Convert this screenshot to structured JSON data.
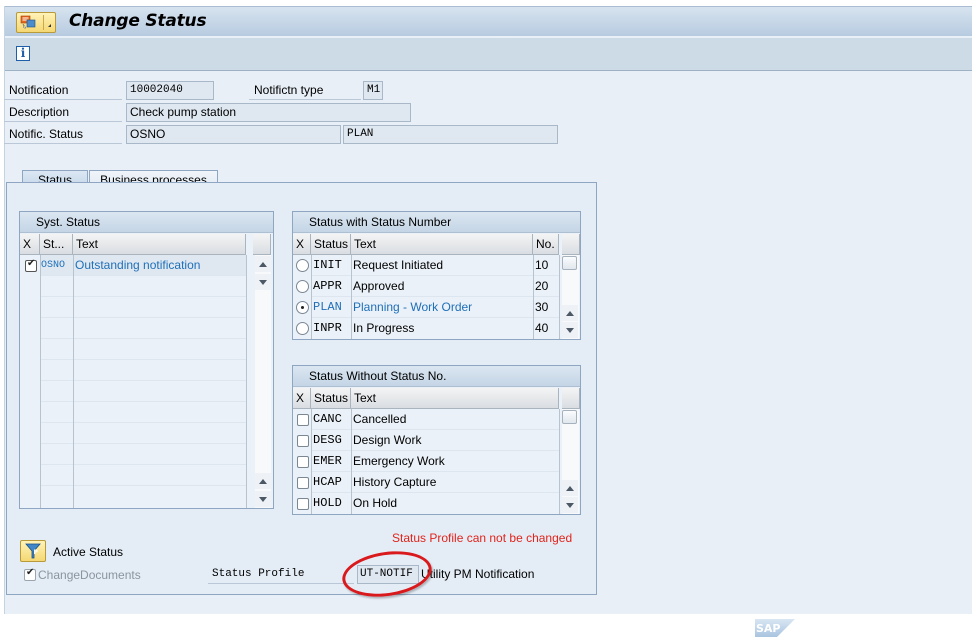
{
  "window": {
    "title": "Change Status"
  },
  "toolbar": {
    "info_icon": "i"
  },
  "header": {
    "notification_label": "Notification",
    "notification_value": "10002040",
    "notif_type_label": "Notifictn type",
    "notif_type_value": "M1",
    "description_label": "Description",
    "description_value": "Check pump station",
    "notif_status_label": "Notific. Status",
    "notif_status_value1": "OSNO",
    "notif_status_value2": "PLAN"
  },
  "tabs": [
    {
      "label": "Status",
      "active": true
    },
    {
      "label": "Business processes",
      "active": false
    }
  ],
  "syst_status": {
    "title": "Syst. Status",
    "columns": [
      "X",
      "St...",
      "Text"
    ],
    "rows": [
      {
        "checked": true,
        "status": "OSNO",
        "text": "Outstanding notification"
      }
    ]
  },
  "status_with_number": {
    "title": "Status with Status Number",
    "columns": [
      "X",
      "Status",
      "Text",
      "No."
    ],
    "rows": [
      {
        "selected": false,
        "status": "INIT",
        "text": "Request Initiated",
        "no": "10"
      },
      {
        "selected": false,
        "status": "APPR",
        "text": "Approved",
        "no": "20"
      },
      {
        "selected": true,
        "status": "PLAN",
        "text": "Planning - Work Order",
        "no": "30"
      },
      {
        "selected": false,
        "status": "INPR",
        "text": "In Progress",
        "no": "40"
      }
    ]
  },
  "status_without_number": {
    "title": "Status Without Status No.",
    "columns": [
      "X",
      "Status",
      "Text"
    ],
    "rows": [
      {
        "checked": false,
        "status": "CANC",
        "text": "Cancelled"
      },
      {
        "checked": false,
        "status": "DESG",
        "text": "Design Work"
      },
      {
        "checked": false,
        "status": "EMER",
        "text": "Emergency Work"
      },
      {
        "checked": false,
        "status": "HCAP",
        "text": "History Capture"
      },
      {
        "checked": false,
        "status": "HOLD",
        "text": "On Hold"
      }
    ]
  },
  "footer": {
    "error_message": "Status Profile can not be changed",
    "active_status_label": "Active Status",
    "change_documents_label": "ChangeDocuments",
    "change_documents_checked": true,
    "status_profile_label": "Status Profile",
    "status_profile_value": "UT-NOTIF",
    "status_profile_desc": "Utility PM Notification"
  },
  "colors": {
    "accent_selected": "#1f6fb8",
    "error": "#e2231a",
    "annotation_circle": "#d9191c"
  },
  "branding": {
    "logo_text": "SAP"
  }
}
